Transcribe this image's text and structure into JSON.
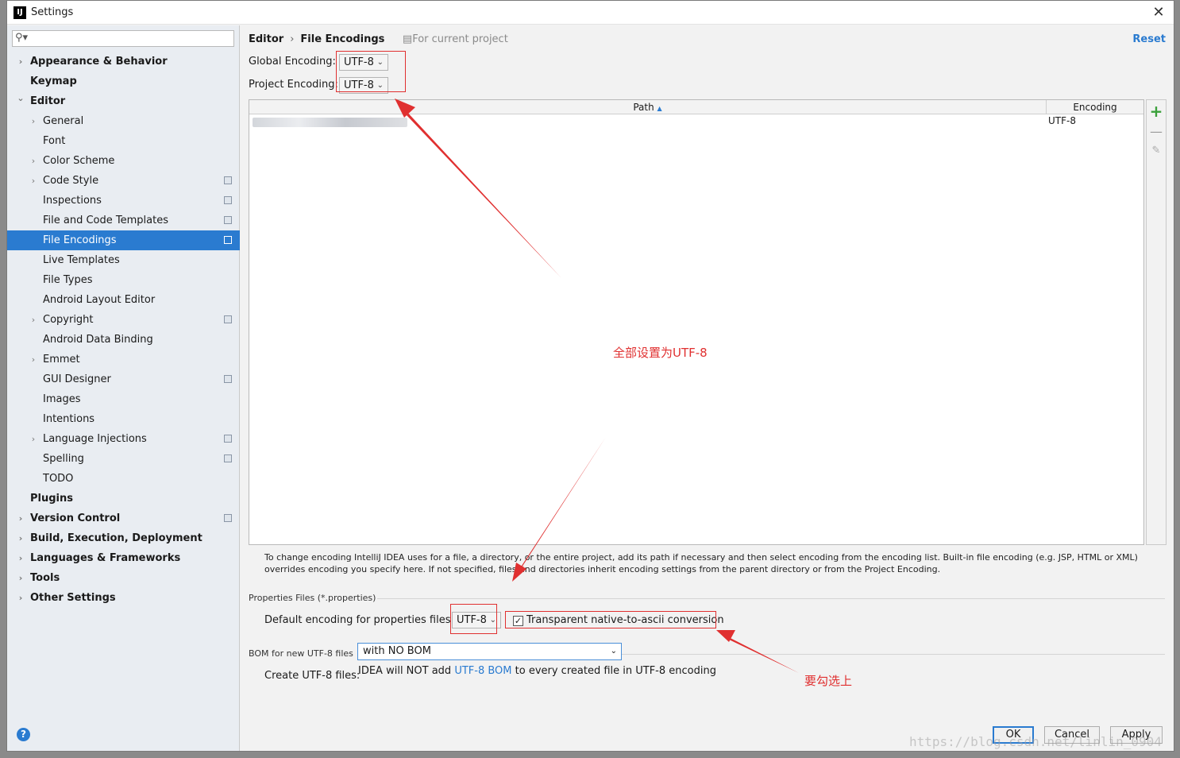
{
  "window": {
    "title": "Settings",
    "app_icon": "IJ"
  },
  "sidebar": {
    "search_placeholder": "",
    "items": [
      {
        "label": "Appearance & Behavior",
        "bold": true,
        "arrow": "right",
        "level": 0,
        "project": false,
        "selected": false
      },
      {
        "label": "Keymap",
        "bold": true,
        "arrow": "",
        "level": 0,
        "project": false,
        "selected": false
      },
      {
        "label": "Editor",
        "bold": true,
        "arrow": "down",
        "level": 0,
        "project": false,
        "selected": false
      },
      {
        "label": "General",
        "bold": false,
        "arrow": "right",
        "level": 1,
        "project": false,
        "selected": false
      },
      {
        "label": "Font",
        "bold": false,
        "arrow": "",
        "level": 1,
        "project": false,
        "selected": false
      },
      {
        "label": "Color Scheme",
        "bold": false,
        "arrow": "right",
        "level": 1,
        "project": false,
        "selected": false
      },
      {
        "label": "Code Style",
        "bold": false,
        "arrow": "right",
        "level": 1,
        "project": true,
        "selected": false
      },
      {
        "label": "Inspections",
        "bold": false,
        "arrow": "",
        "level": 1,
        "project": true,
        "selected": false
      },
      {
        "label": "File and Code Templates",
        "bold": false,
        "arrow": "",
        "level": 1,
        "project": true,
        "selected": false
      },
      {
        "label": "File Encodings",
        "bold": false,
        "arrow": "",
        "level": 1,
        "project": true,
        "selected": true
      },
      {
        "label": "Live Templates",
        "bold": false,
        "arrow": "",
        "level": 1,
        "project": false,
        "selected": false
      },
      {
        "label": "File Types",
        "bold": false,
        "arrow": "",
        "level": 1,
        "project": false,
        "selected": false
      },
      {
        "label": "Android Layout Editor",
        "bold": false,
        "arrow": "",
        "level": 1,
        "project": false,
        "selected": false
      },
      {
        "label": "Copyright",
        "bold": false,
        "arrow": "right",
        "level": 1,
        "project": true,
        "selected": false
      },
      {
        "label": "Android Data Binding",
        "bold": false,
        "arrow": "",
        "level": 1,
        "project": false,
        "selected": false
      },
      {
        "label": "Emmet",
        "bold": false,
        "arrow": "right",
        "level": 1,
        "project": false,
        "selected": false
      },
      {
        "label": "GUI Designer",
        "bold": false,
        "arrow": "",
        "level": 1,
        "project": true,
        "selected": false
      },
      {
        "label": "Images",
        "bold": false,
        "arrow": "",
        "level": 1,
        "project": false,
        "selected": false
      },
      {
        "label": "Intentions",
        "bold": false,
        "arrow": "",
        "level": 1,
        "project": false,
        "selected": false
      },
      {
        "label": "Language Injections",
        "bold": false,
        "arrow": "right",
        "level": 1,
        "project": true,
        "selected": false
      },
      {
        "label": "Spelling",
        "bold": false,
        "arrow": "",
        "level": 1,
        "project": true,
        "selected": false
      },
      {
        "label": "TODO",
        "bold": false,
        "arrow": "",
        "level": 1,
        "project": false,
        "selected": false
      },
      {
        "label": "Plugins",
        "bold": true,
        "arrow": "",
        "level": 0,
        "project": false,
        "selected": false
      },
      {
        "label": "Version Control",
        "bold": true,
        "arrow": "right",
        "level": 0,
        "project": true,
        "selected": false
      },
      {
        "label": "Build, Execution, Deployment",
        "bold": true,
        "arrow": "right",
        "level": 0,
        "project": false,
        "selected": false
      },
      {
        "label": "Languages & Frameworks",
        "bold": true,
        "arrow": "right",
        "level": 0,
        "project": false,
        "selected": false
      },
      {
        "label": "Tools",
        "bold": true,
        "arrow": "right",
        "level": 0,
        "project": false,
        "selected": false
      },
      {
        "label": "Other Settings",
        "bold": true,
        "arrow": "right",
        "level": 0,
        "project": false,
        "selected": false
      }
    ]
  },
  "header": {
    "crumb_parent": "Editor",
    "crumb_sep": "›",
    "crumb_current": "File Encodings",
    "for_project": "For current project",
    "reset": "Reset"
  },
  "encodings": {
    "global_label": "Global Encoding:",
    "global_value": "UTF-8",
    "project_label": "Project Encoding:",
    "project_value": "UTF-8"
  },
  "table": {
    "col_path": "Path",
    "sort_indicator": "▲",
    "col_encoding": "Encoding",
    "rows": [
      {
        "path": "",
        "encoding": "UTF-8"
      }
    ]
  },
  "info_text": "To change encoding IntelliJ IDEA uses for a file, a directory, or the entire project, add its path if necessary and then select encoding from the encoding list. Built-in file encoding (e.g. JSP, HTML or XML) overrides encoding you specify here. If not specified, files and directories inherit encoding settings from the parent directory or from the Project Encoding.",
  "properties": {
    "section": "Properties Files (*.properties)",
    "default_label": "Default encoding for properties files:",
    "default_value": "UTF-8",
    "transparent_label": "Transparent native-to-ascii conversion",
    "transparent_checked": true
  },
  "bom": {
    "section": "BOM for new UTF-8 files",
    "create_label": "Create UTF-8 files:",
    "create_value": "with NO BOM",
    "note_pre": "IDEA will NOT add ",
    "note_link": "UTF-8 BOM",
    "note_post": " to every created file in UTF-8 encoding"
  },
  "footer": {
    "ok": "OK",
    "cancel": "Cancel",
    "apply": "Apply",
    "help": "?"
  },
  "annotations": {
    "note_top": "全部设置为UTF-8",
    "note_bottom": "要勾选上",
    "color": "#e03030"
  },
  "watermark": "https://blog.csdn.net/linlin_0904",
  "colors": {
    "accent": "#2a7bd0",
    "selection": "#2a7bd0",
    "add": "#3aa03a"
  }
}
